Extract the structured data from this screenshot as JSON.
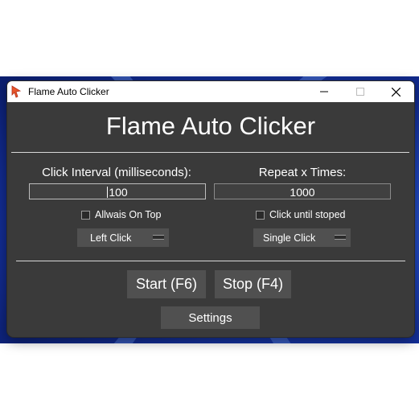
{
  "window": {
    "title": "Flame Auto Clicker"
  },
  "app": {
    "heading": "Flame Auto Clicker"
  },
  "interval": {
    "label": "Click Interval (milliseconds):",
    "value": "100"
  },
  "repeat": {
    "label": "Repeat x Times:",
    "value": "1000"
  },
  "options": {
    "always_on_top": {
      "label": "Allwais On Top",
      "checked": false
    },
    "click_until_stopped": {
      "label": "Click until stoped",
      "checked": false
    }
  },
  "dropdowns": {
    "mouse_button": {
      "selected": "Left Click"
    },
    "click_type": {
      "selected": "Single Click"
    }
  },
  "buttons": {
    "start": "Start (F6)",
    "stop": "Stop (F4)",
    "settings": "Settings"
  },
  "colors": {
    "window_bg": "#3a3a3a",
    "button_bg": "#505050",
    "text": "#ffffff"
  }
}
